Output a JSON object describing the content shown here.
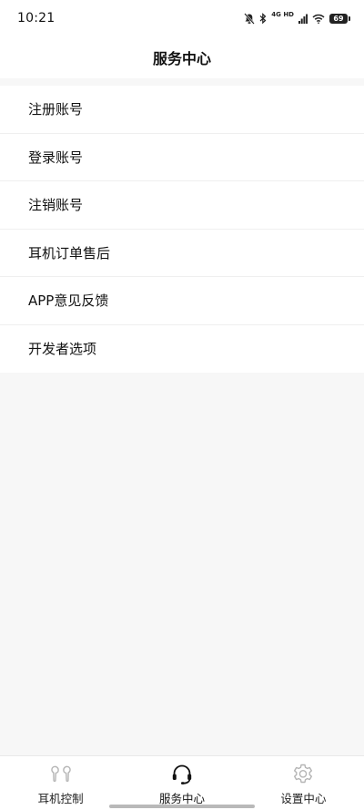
{
  "status_bar": {
    "time": "10:21",
    "network": "4G HD",
    "battery": "69",
    "icons": [
      "mute-icon",
      "bluetooth-icon",
      "signal-icon",
      "wifi-icon",
      "battery-icon"
    ]
  },
  "header": {
    "title": "服务中心"
  },
  "menu": {
    "items": [
      {
        "label": "注册账号"
      },
      {
        "label": "登录账号"
      },
      {
        "label": "注销账号"
      },
      {
        "label": "耳机订单售后"
      },
      {
        "label": "APP意见反馈"
      },
      {
        "label": "开发者选项"
      }
    ]
  },
  "tabs": [
    {
      "label": "耳机控制",
      "icon": "earbuds-icon",
      "active": false
    },
    {
      "label": "服务中心",
      "icon": "headset-icon",
      "active": true
    },
    {
      "label": "设置中心",
      "icon": "gear-icon",
      "active": false
    }
  ],
  "colors": {
    "background": "#f7f7f7",
    "surface": "#ffffff",
    "text": "#111111",
    "inactive_icon": "#b5b5b5",
    "active_icon": "#111111"
  }
}
